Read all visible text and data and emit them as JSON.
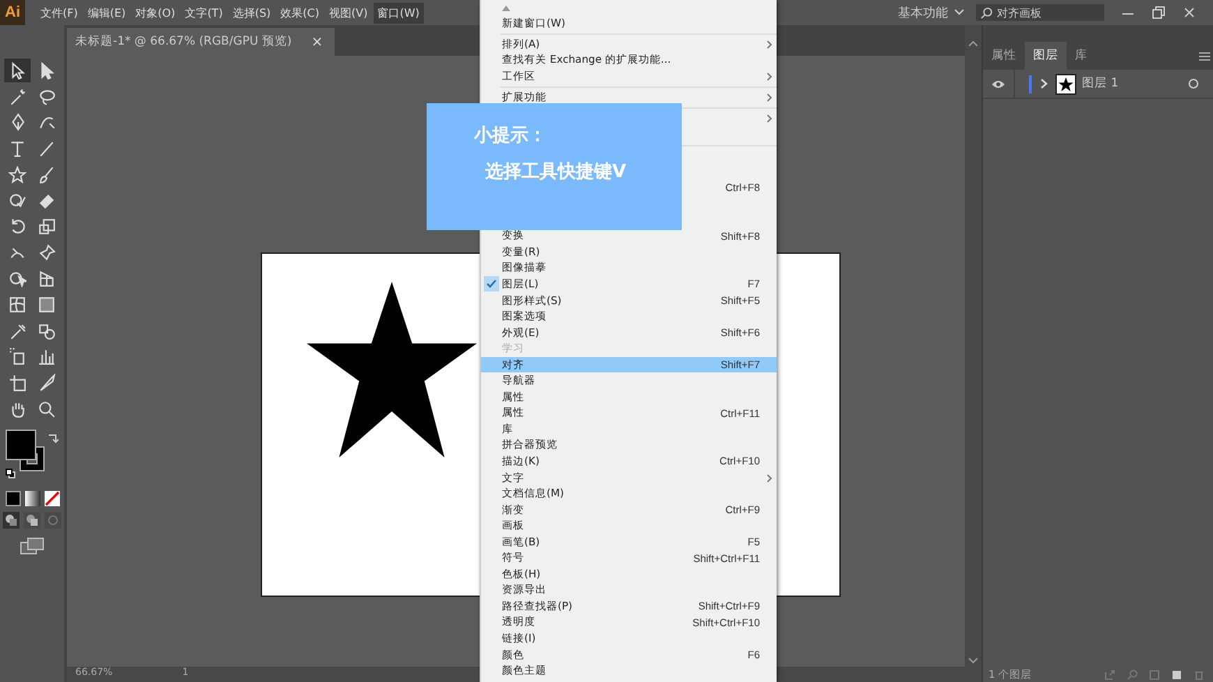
{
  "app": {
    "logo": "Ai",
    "menus": [
      {
        "label": "文件(F)",
        "selected": false
      },
      {
        "label": "编辑(E)",
        "selected": false
      },
      {
        "label": "对象(O)",
        "selected": false
      },
      {
        "label": "文字(T)",
        "selected": false
      },
      {
        "label": "选择(S)",
        "selected": false
      },
      {
        "label": "效果(C)",
        "selected": false
      },
      {
        "label": "视图(V)",
        "selected": false
      },
      {
        "label": "窗口(W)",
        "selected": true
      }
    ],
    "workspace": "基本功能",
    "search": {
      "value": "对齐画板"
    }
  },
  "document_tab": {
    "title": "未标题-1* @ 66.67% (RGB/GPU 预览)",
    "close": "×"
  },
  "status_bar": {
    "zoom": "66.67%",
    "artboard": "1"
  },
  "menu": {
    "items": [
      {
        "kind": "scroll-up"
      },
      {
        "kind": "item",
        "label": "新建窗口(W)",
        "submenu": false,
        "checked": false,
        "disabled": false,
        "selected": false
      },
      {
        "kind": "separator"
      },
      {
        "kind": "item",
        "label": "排列(A)",
        "submenu": true,
        "checked": false,
        "disabled": false,
        "selected": false
      },
      {
        "kind": "item",
        "label": "查找有关 Exchange 的扩展功能...",
        "submenu": false,
        "checked": false,
        "disabled": false,
        "selected": false
      },
      {
        "kind": "item",
        "label": "工作区",
        "submenu": true,
        "checked": false,
        "disabled": false,
        "selected": false
      },
      {
        "kind": "separator"
      },
      {
        "kind": "item",
        "label": "扩展功能",
        "submenu": true,
        "checked": false,
        "disabled": false,
        "selected": false
      },
      {
        "kind": "separator"
      },
      {
        "kind": "item",
        "submenu": true
      },
      {
        "kind": "item"
      },
      {
        "kind": "separator"
      },
      {
        "kind": "item"
      },
      {
        "kind": "item"
      },
      {
        "kind": "item",
        "shortcut": "Ctrl+F8",
        "submenu": false
      },
      {
        "kind": "item"
      },
      {
        "kind": "item"
      },
      {
        "kind": "item",
        "label": "变换",
        "shortcut": "Shift+F8",
        "submenu": false,
        "checked": false,
        "disabled": false,
        "selected": false
      },
      {
        "kind": "item",
        "label": "变量(R)",
        "submenu": false,
        "checked": false,
        "disabled": false,
        "selected": false
      },
      {
        "kind": "item",
        "label": "图像描摹",
        "submenu": false,
        "checked": false,
        "disabled": false,
        "selected": false
      },
      {
        "kind": "item",
        "label": "图层(L)",
        "shortcut": "F7",
        "submenu": false,
        "checked": true,
        "disabled": false,
        "selected": false
      },
      {
        "kind": "item",
        "label": "图形样式(S)",
        "shortcut": "Shift+F5",
        "submenu": false,
        "checked": false,
        "disabled": false,
        "selected": false
      },
      {
        "kind": "item",
        "label": "图案选项",
        "submenu": false,
        "checked": false,
        "disabled": false,
        "selected": false
      },
      {
        "kind": "item",
        "label": "外观(E)",
        "shortcut": "Shift+F6",
        "submenu": false,
        "checked": false,
        "disabled": false,
        "selected": false
      },
      {
        "kind": "item",
        "label": "学习",
        "submenu": false,
        "checked": false,
        "disabled": true,
        "selected": false
      },
      {
        "kind": "item",
        "label": "对齐",
        "shortcut": "Shift+F7",
        "submenu": false,
        "checked": false,
        "disabled": false,
        "selected": true
      },
      {
        "kind": "item",
        "label": "导航器",
        "submenu": false,
        "checked": false,
        "disabled": false,
        "selected": false
      },
      {
        "kind": "item",
        "label": "属性",
        "submenu": false,
        "checked": false,
        "disabled": false,
        "selected": false
      },
      {
        "kind": "item",
        "label": "属性",
        "shortcut": "Ctrl+F11",
        "submenu": false,
        "checked": false,
        "disabled": false,
        "selected": false
      },
      {
        "kind": "item",
        "label": "库",
        "submenu": false,
        "checked": false,
        "disabled": false,
        "selected": false
      },
      {
        "kind": "item",
        "label": "拼合器预览",
        "submenu": false,
        "checked": false,
        "disabled": false,
        "selected": false
      },
      {
        "kind": "item",
        "label": "描边(K)",
        "shortcut": "Ctrl+F10",
        "submenu": false,
        "checked": false,
        "disabled": false,
        "selected": false
      },
      {
        "kind": "item",
        "label": "文字",
        "submenu": true,
        "checked": false,
        "disabled": false,
        "selected": false
      },
      {
        "kind": "item",
        "label": "文档信息(M)",
        "submenu": false,
        "checked": false,
        "disabled": false,
        "selected": false
      },
      {
        "kind": "item",
        "label": "渐变",
        "shortcut": "Ctrl+F9",
        "submenu": false,
        "checked": false,
        "disabled": false,
        "selected": false
      },
      {
        "kind": "item",
        "label": "画板",
        "submenu": false,
        "checked": false,
        "disabled": false,
        "selected": false
      },
      {
        "kind": "item",
        "label": "画笔(B)",
        "shortcut": "F5",
        "submenu": false,
        "checked": false,
        "disabled": false,
        "selected": false
      },
      {
        "kind": "item",
        "label": "符号",
        "shortcut": "Shift+Ctrl+F11",
        "submenu": false,
        "checked": false,
        "disabled": false,
        "selected": false
      },
      {
        "kind": "item",
        "label": "色板(H)",
        "submenu": false,
        "checked": false,
        "disabled": false,
        "selected": false
      },
      {
        "kind": "item",
        "label": "资源导出",
        "submenu": false,
        "checked": false,
        "disabled": false,
        "selected": false
      },
      {
        "kind": "item",
        "label": "路径查找器(P)",
        "shortcut": "Shift+Ctrl+F9",
        "submenu": false,
        "checked": false,
        "disabled": false,
        "selected": false
      },
      {
        "kind": "item",
        "label": "透明度",
        "shortcut": "Shift+Ctrl+F10",
        "submenu": false,
        "checked": false,
        "disabled": false,
        "selected": false
      },
      {
        "kind": "item",
        "label": "链接(I)",
        "submenu": false,
        "checked": false,
        "disabled": false,
        "selected": false
      },
      {
        "kind": "item",
        "label": "颜色",
        "shortcut": "F6",
        "submenu": false,
        "checked": false,
        "disabled": false,
        "selected": false
      },
      {
        "kind": "item",
        "label": "颜色主题",
        "submenu": false,
        "checked": false,
        "disabled": false,
        "selected": false
      }
    ]
  },
  "tip": {
    "title": "小提示：",
    "text": "选择工具快捷键V"
  },
  "panel": {
    "tabs": [
      {
        "label": "属性",
        "selected": false
      },
      {
        "label": "图层",
        "selected": true
      },
      {
        "label": "库",
        "selected": false
      }
    ],
    "layers": [
      {
        "name": "图层 1",
        "visible": true,
        "expanded": false,
        "color": "#4a78f0"
      }
    ],
    "footer": "1 个图层"
  }
}
